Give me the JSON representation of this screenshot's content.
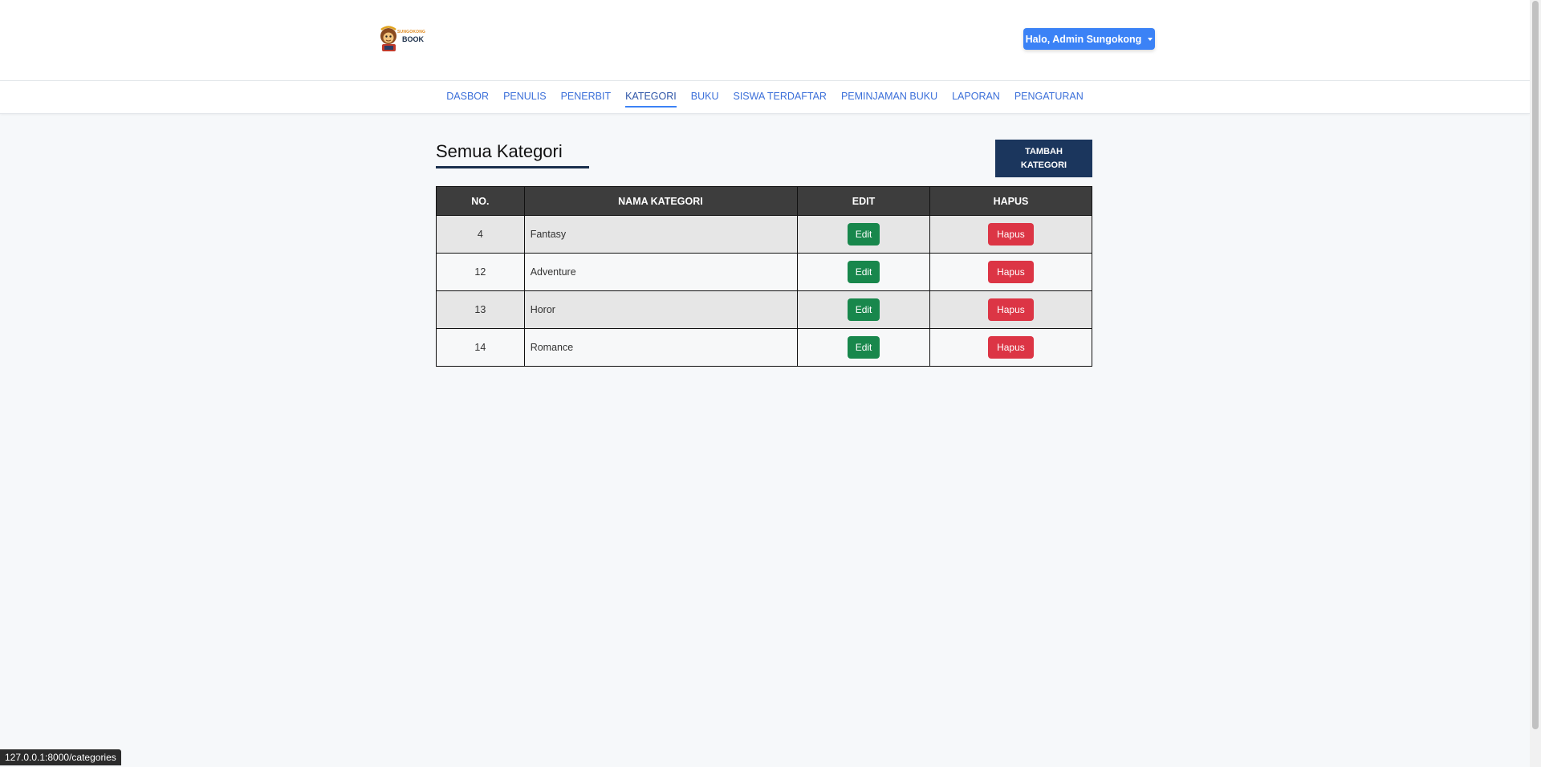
{
  "header": {
    "logo_top": "SUNGOKONG",
    "logo_main": "BOOK",
    "user_label": "Halo, Admin Sungokong"
  },
  "nav": [
    {
      "label": "DASBOR"
    },
    {
      "label": "PENULIS"
    },
    {
      "label": "PENERBIT"
    },
    {
      "label": "KATEGORI",
      "active": true
    },
    {
      "label": "BUKU"
    },
    {
      "label": "SISWA TERDAFTAR"
    },
    {
      "label": "PEMINJAMAN BUKU"
    },
    {
      "label": "LAPORAN"
    },
    {
      "label": "PENGATURAN"
    }
  ],
  "main": {
    "title": "Semua Kategori",
    "add_button_line1": "TAMBAH",
    "add_button_line2": "KATEGORI"
  },
  "table": {
    "headers": [
      "NO.",
      "NAMA KATEGORI",
      "EDIT",
      "HAPUS"
    ],
    "rows": [
      {
        "no": "4",
        "name": "Fantasy",
        "edit": "Edit",
        "delete": "Hapus"
      },
      {
        "no": "12",
        "name": "Adventure",
        "edit": "Edit",
        "delete": "Hapus"
      },
      {
        "no": "13",
        "name": "Horor",
        "edit": "Edit",
        "delete": "Hapus"
      },
      {
        "no": "14",
        "name": "Romance",
        "edit": "Edit",
        "delete": "Hapus"
      }
    ]
  },
  "status": {
    "url": "127.0.0.1:8000/categories"
  },
  "colors": {
    "accent": "#3b82f6",
    "edit": "#18874c",
    "delete": "#dc3545",
    "add": "#1b365d"
  }
}
